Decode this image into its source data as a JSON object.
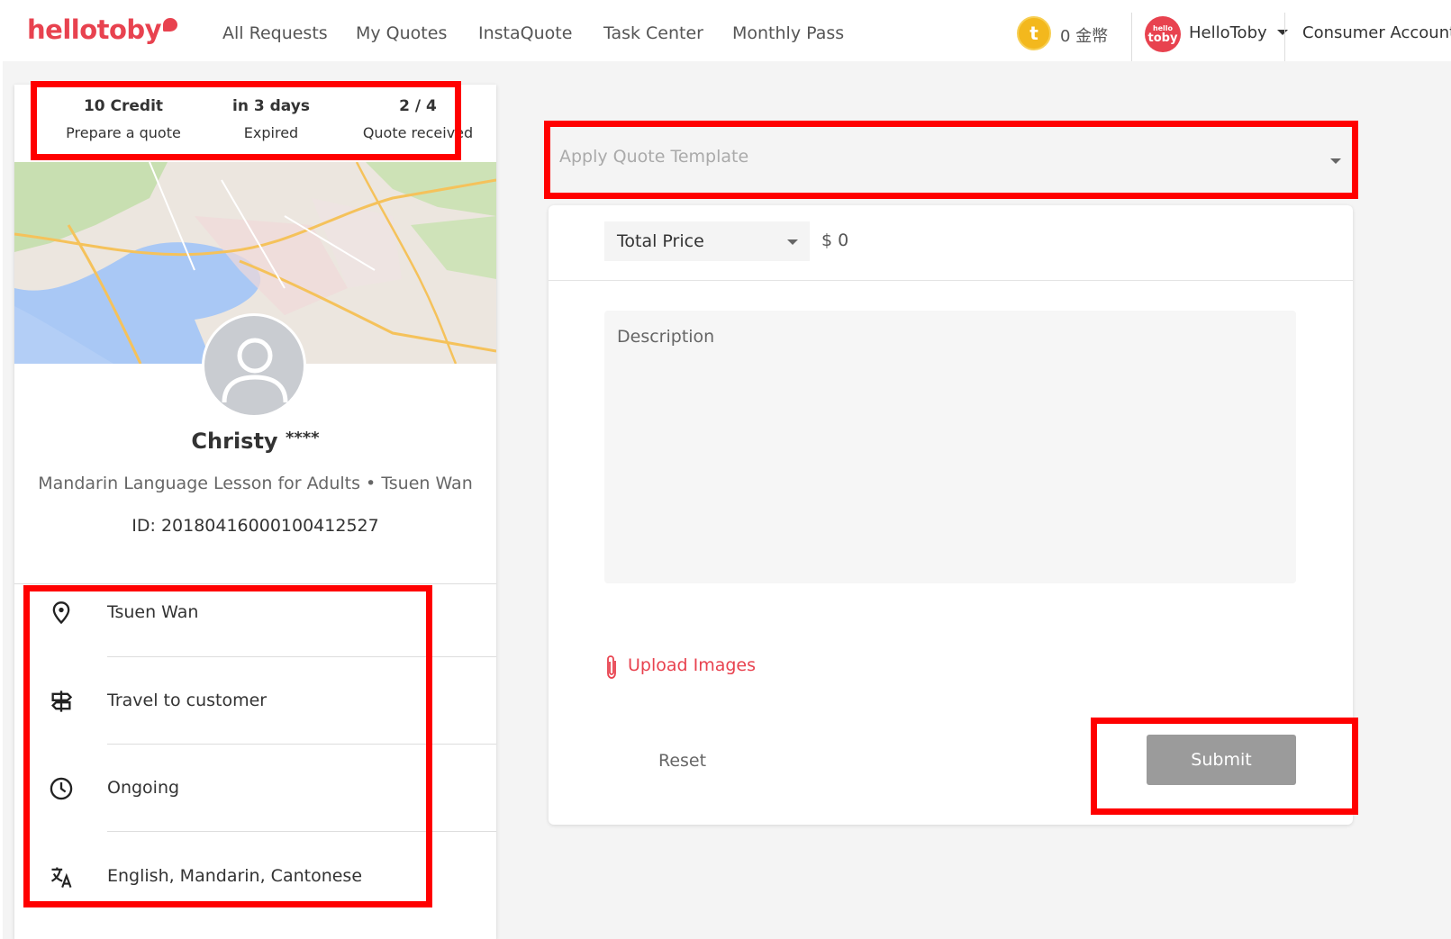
{
  "nav": {
    "logo": "hellotoby",
    "links": [
      "All Requests",
      "My Quotes",
      "InstaQuote",
      "Task Center",
      "Monthly Pass"
    ],
    "coin_symbol": "t",
    "coins": "0 金幣",
    "avatar_text_top": "hello",
    "avatar_text_bottom": "toby",
    "user_name": "HelloToby",
    "account_switch": "Consumer Account"
  },
  "summary": {
    "credit_value": "10 Credit",
    "credit_label": "Prepare a quote",
    "expiry_value": "in 3 days",
    "expiry_label": "Expired",
    "quotes_value": "2 / 4",
    "quotes_label": "Quote received"
  },
  "customer": {
    "name": "Christy",
    "name_suffix": "****",
    "service": "Mandarin Language Lesson for Adults",
    "separator": "•",
    "location": "Tsuen Wan",
    "request_id": "ID: 20180416000100412527"
  },
  "details": [
    {
      "icon": "location-pin-icon",
      "text": "Tsuen Wan"
    },
    {
      "icon": "signpost-icon",
      "text": "Travel to customer"
    },
    {
      "icon": "clock-icon",
      "text": "Ongoing"
    },
    {
      "icon": "translate-icon",
      "text": "English, Mandarin, Cantonese"
    }
  ],
  "quote_form": {
    "template_placeholder": "Apply Quote Template",
    "price_type": "Total Price",
    "price_value": "$ 0",
    "description_placeholder": "Description",
    "upload_label": "Upload Images",
    "reset_label": "Reset",
    "submit_label": "Submit"
  },
  "colors": {
    "brand": "#e8424f",
    "annotation": "#ff0000",
    "submit_disabled": "#9b9b9b",
    "coin": "#f3b81d"
  }
}
